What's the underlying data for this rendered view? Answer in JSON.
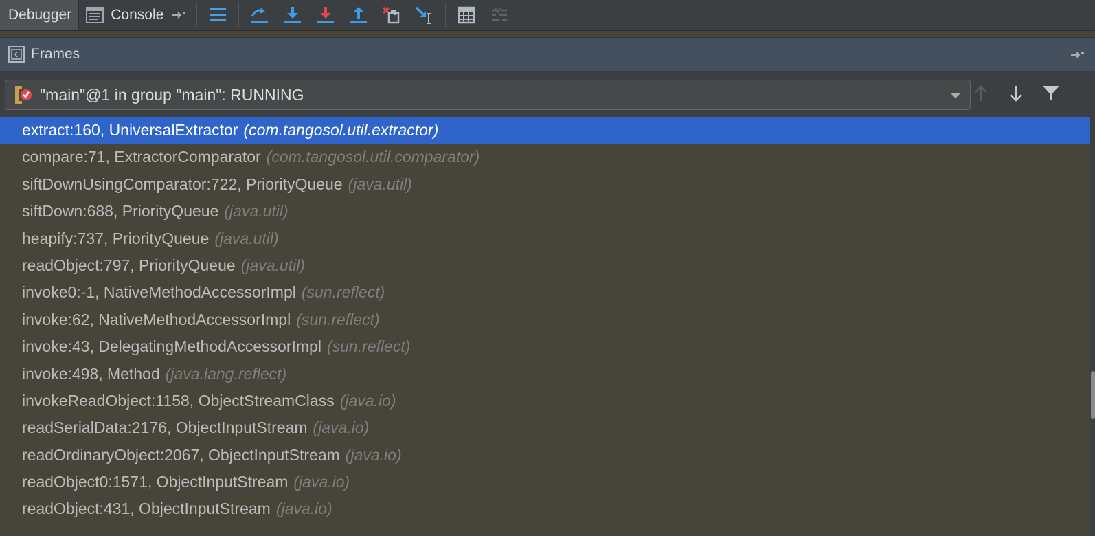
{
  "toolbar": {
    "debugger_tab": "Debugger",
    "console_tab": "Console",
    "icons": [
      "layout-lines-icon",
      "step-over-icon",
      "step-into-icon",
      "force-step-into-icon",
      "step-out-icon",
      "drop-frame-icon",
      "run-to-cursor-icon",
      "evaluate-expression-icon",
      "trace-stream-icon"
    ]
  },
  "frames_panel": {
    "title": "Frames",
    "thread": "\"main\"@1 in group \"main\": RUNNING",
    "frames": [
      {
        "method": "extract:160, UniversalExtractor",
        "package": "(com.tangosol.util.extractor)"
      },
      {
        "method": "compare:71, ExtractorComparator",
        "package": "(com.tangosol.util.comparator)"
      },
      {
        "method": "siftDownUsingComparator:722, PriorityQueue",
        "package": "(java.util)"
      },
      {
        "method": "siftDown:688, PriorityQueue",
        "package": "(java.util)"
      },
      {
        "method": "heapify:737, PriorityQueue",
        "package": "(java.util)"
      },
      {
        "method": "readObject:797, PriorityQueue",
        "package": "(java.util)"
      },
      {
        "method": "invoke0:-1, NativeMethodAccessorImpl",
        "package": "(sun.reflect)"
      },
      {
        "method": "invoke:62, NativeMethodAccessorImpl",
        "package": "(sun.reflect)"
      },
      {
        "method": "invoke:43, DelegatingMethodAccessorImpl",
        "package": "(sun.reflect)"
      },
      {
        "method": "invoke:498, Method",
        "package": "(java.lang.reflect)"
      },
      {
        "method": "invokeReadObject:1158, ObjectStreamClass",
        "package": "(java.io)"
      },
      {
        "method": "readSerialData:2176, ObjectInputStream",
        "package": "(java.io)"
      },
      {
        "method": "readOrdinaryObject:2067, ObjectInputStream",
        "package": "(java.io)"
      },
      {
        "method": "readObject0:1571, ObjectInputStream",
        "package": "(java.io)"
      },
      {
        "method": "readObject:431, ObjectInputStream",
        "package": "(java.io)"
      }
    ],
    "selected_index": 0
  },
  "colors": {
    "toolbar_bg": "#3c3f41",
    "frames_header_bg": "#45505e",
    "list_bg": "#474439",
    "selection": "#2f65ca",
    "step_icon_blue": "#3d9be9",
    "force_step_red": "#e0474f"
  }
}
